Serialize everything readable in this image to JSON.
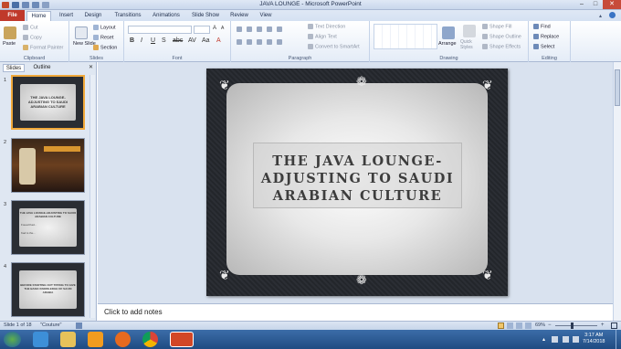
{
  "window": {
    "title": "JAVA LOUNGE - Microsoft PowerPoint"
  },
  "tabs": [
    "File",
    "Home",
    "Insert",
    "Design",
    "Transitions",
    "Animations",
    "Slide Show",
    "Review",
    "View"
  ],
  "ribbon": {
    "clipboard": {
      "label": "Clipboard",
      "paste": "Paste",
      "cut": "Cut",
      "copy": "Copy",
      "format_painter": "Format Painter"
    },
    "slides": {
      "label": "Slides",
      "new_slide": "New Slide",
      "layout": "Layout",
      "reset": "Reset",
      "section": "Section"
    },
    "font": {
      "label": "Font"
    },
    "paragraph": {
      "label": "Paragraph",
      "text_direction": "Text Direction",
      "align_text": "Align Text",
      "convert_smartart": "Convert to SmartArt"
    },
    "drawing": {
      "label": "Drawing",
      "arrange": "Arrange",
      "quick_styles": "Quick Styles",
      "shape_fill": "Shape Fill",
      "shape_outline": "Shape Outline",
      "shape_effects": "Shape Effects"
    },
    "editing": {
      "label": "Editing",
      "find": "Find",
      "replace": "Replace",
      "select": "Select"
    }
  },
  "pane_tabs": {
    "slides": "Slides",
    "outline": "Outline"
  },
  "thumbnails": [
    {
      "num": "1",
      "title": "THE JAVA LOUNGE-ADJUSTING TO SAUDI ARABIAN CULTURE"
    },
    {
      "num": "2"
    },
    {
      "num": "3",
      "title": "THE JAVA LOUNGE-ADJUSTING TO SAUDI ARABIAN CULTURE",
      "b1": "Fouad Kad...",
      "b2": "Kad is the..."
    },
    {
      "num": "4",
      "title": "BEFORE STARTING OUT TRYING TO GIVE THE BASIC KNOWLEDGE OF SAUDI ARABIA"
    }
  ],
  "slide": {
    "title": "The Java Lounge-Adjusting to Saudi Arabian Culture"
  },
  "notes": {
    "placeholder": "Click to add notes"
  },
  "status": {
    "slide_info": "Slide 1 of 18",
    "theme": "\"Couture\"",
    "zoom": "69%"
  },
  "taskbar": {
    "time": "3:17 AM",
    "date": "7/14/2018"
  },
  "colors": {
    "file_tab": "#c0392b",
    "accent": "#2b579a",
    "slide_bg": "#26292e"
  }
}
